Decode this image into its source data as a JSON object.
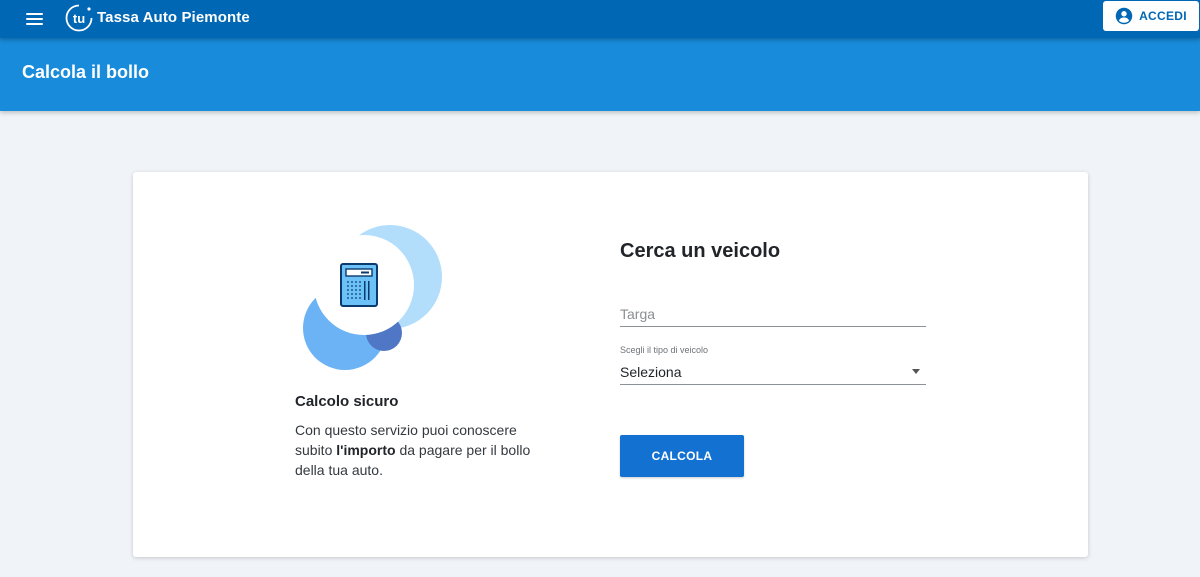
{
  "topbar": {
    "app_title": "Tassa Auto Piemonte",
    "logo_text": "tu",
    "login_label": "ACCEDI",
    "icons": {
      "menu": "menu-icon",
      "logo": "tu-logo-icon",
      "user": "account-circle-icon"
    },
    "colors": {
      "bar": "#0067b4",
      "login_text": "#0067b4"
    }
  },
  "page_header": {
    "title": "Calcola il bollo",
    "color": "#188bda"
  },
  "feature": {
    "title": "Calcolo sicuro",
    "text_before": "Con questo servizio puoi conoscere subito ",
    "text_bold": "l'importo",
    "text_after": " da pagare per il bollo della tua auto.",
    "illustration_icon": "calculator-icon"
  },
  "form": {
    "title": "Cerca un veicolo",
    "targa": {
      "placeholder": "Targa",
      "value": ""
    },
    "vehicle_type": {
      "label": "Scegli il tipo di veicolo",
      "selected": "Seleziona"
    },
    "submit_label": "CALCOLA",
    "submit_color": "#1372d1"
  }
}
